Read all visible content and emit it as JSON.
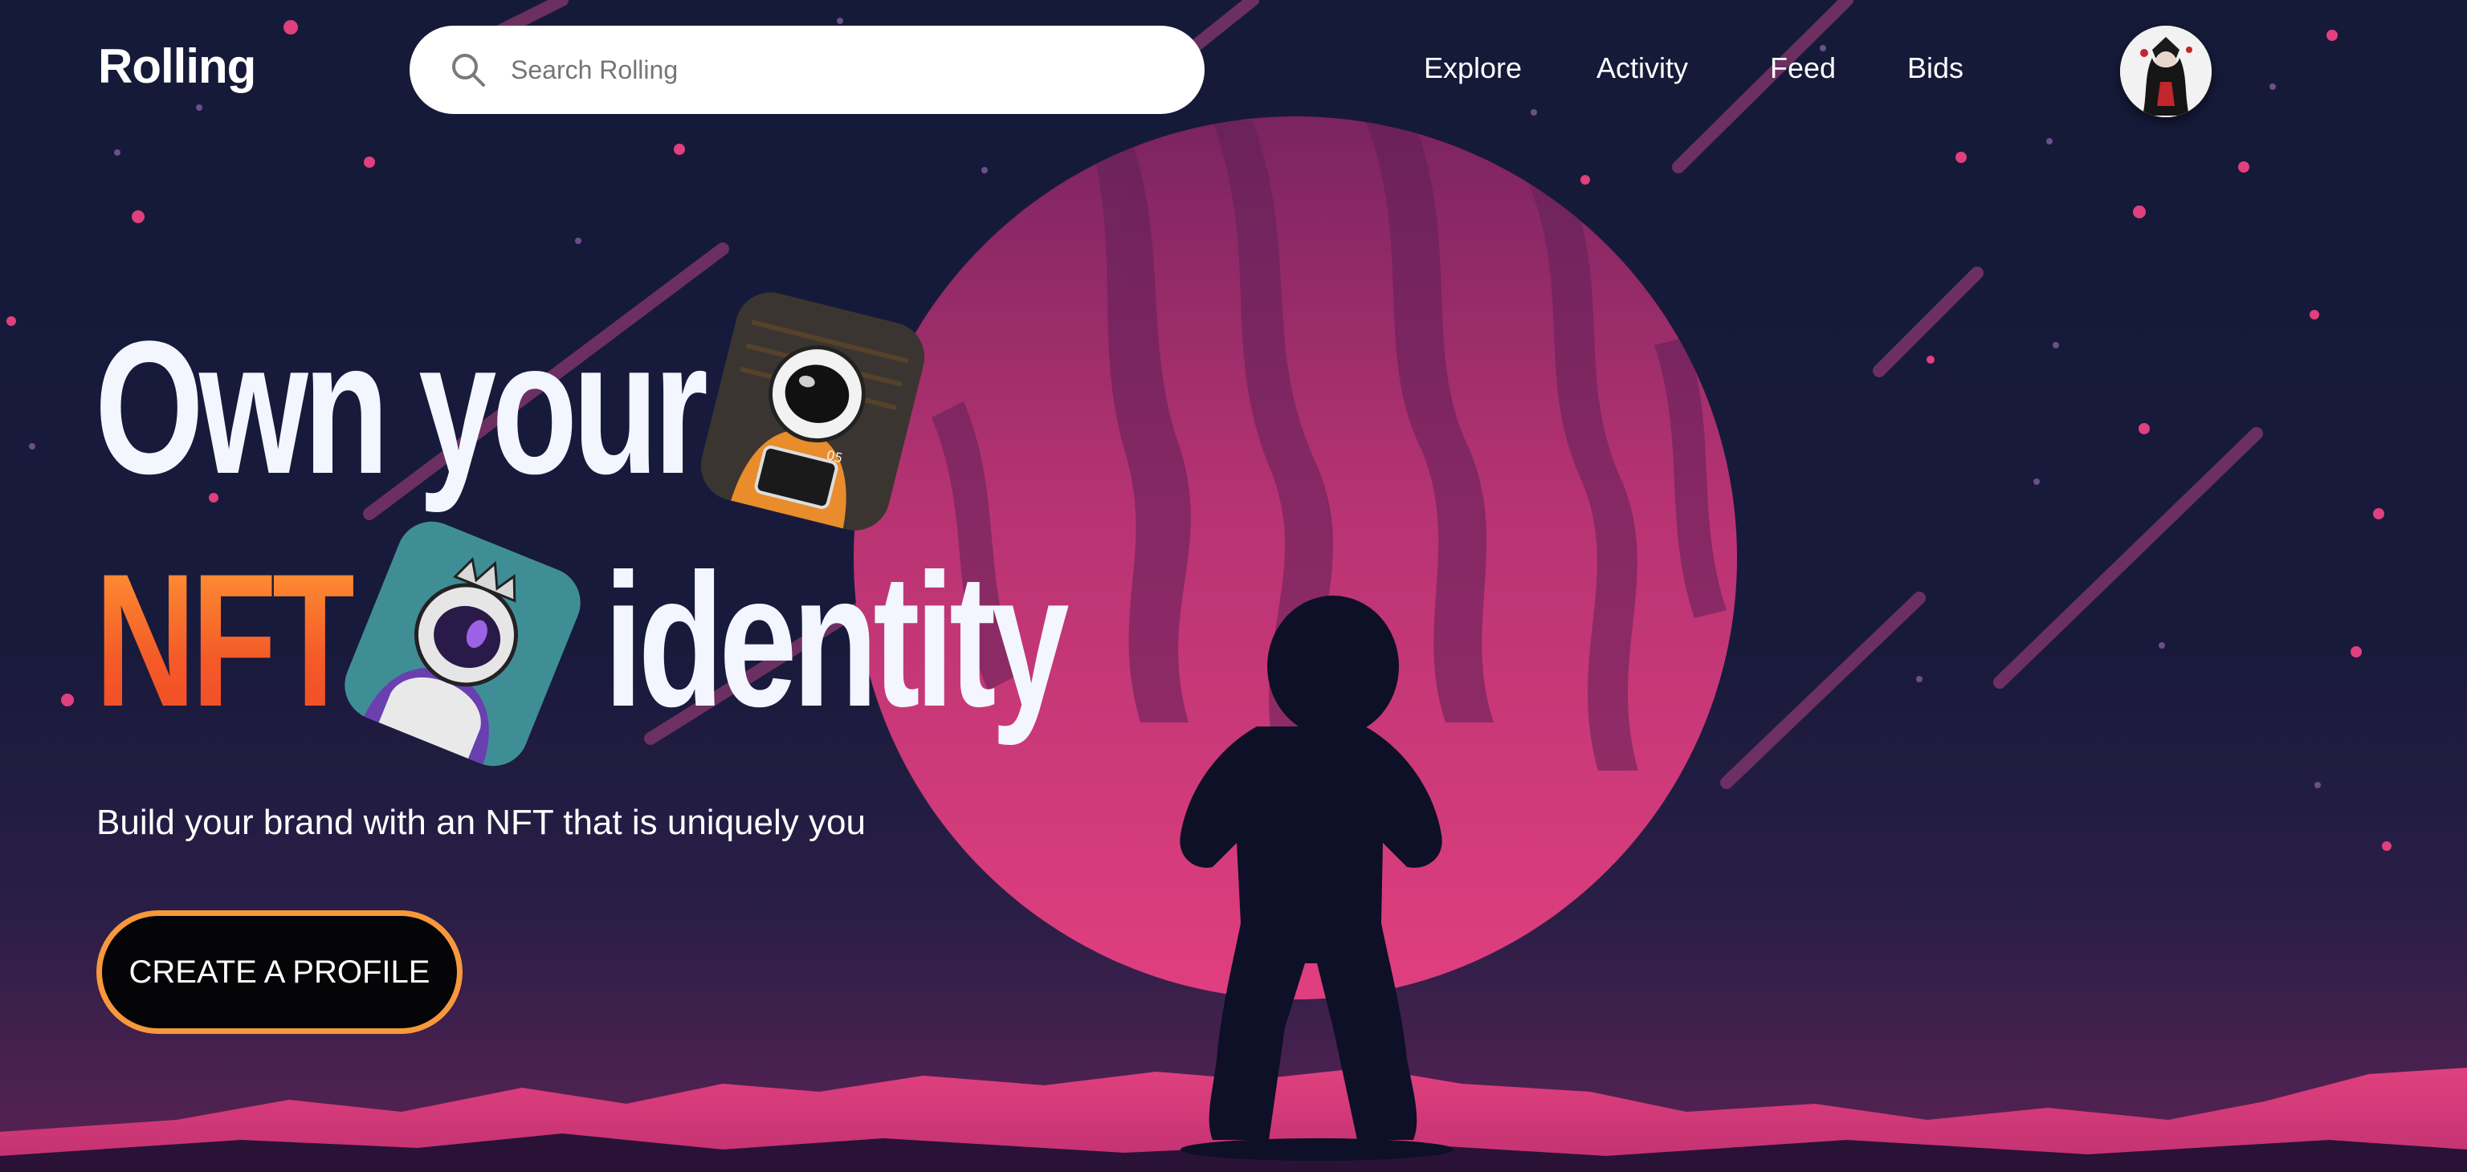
{
  "header": {
    "brand": "Rolling",
    "search": {
      "placeholder": "Search Rolling",
      "value": ""
    },
    "nav": [
      {
        "label": "Explore"
      },
      {
        "label": "Activity"
      },
      {
        "label": "Feed"
      },
      {
        "label": "Bids"
      }
    ],
    "avatar_icon": "user-avatar"
  },
  "hero": {
    "headline_line1": "Own your",
    "headline_accent": "NFT",
    "headline_line2_rest": "identity",
    "subtitle": "Build your brand with an NFT that is uniquely you",
    "cta_label": "CREATE A PROFILE",
    "card1_icon": "astronaut-orange-nft",
    "card2_icon": "astronaut-king-nft"
  },
  "colors": {
    "background": "#161a38",
    "planet": "#e0407e",
    "accent_orange": "#f25f2a",
    "cta_border": "#f7993a",
    "text": "#ffffff"
  }
}
